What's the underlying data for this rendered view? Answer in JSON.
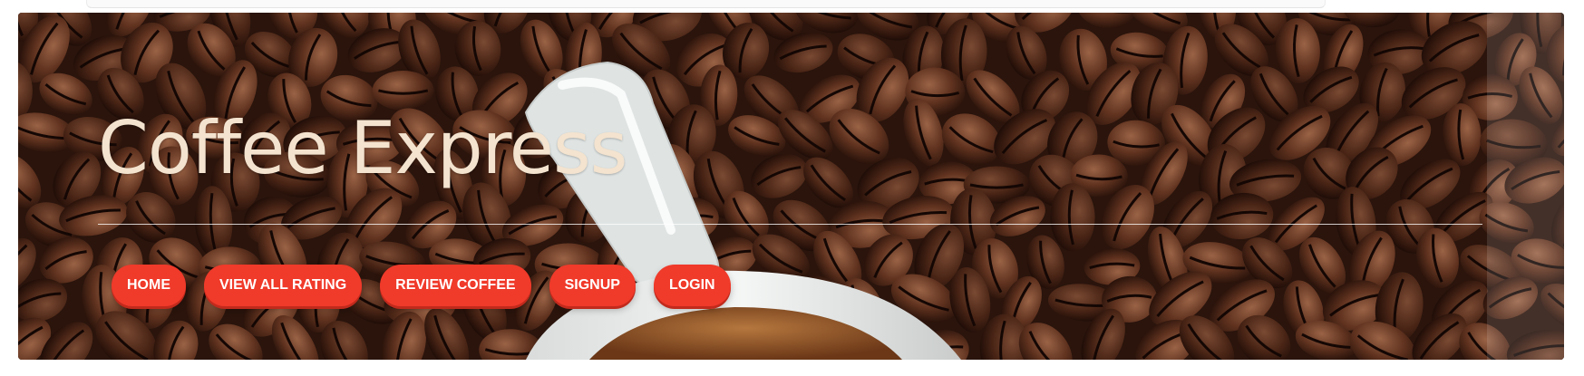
{
  "site": {
    "title": "Coffee Express"
  },
  "nav": {
    "items": [
      {
        "label": "HOME"
      },
      {
        "label": "VIEW ALL RATING"
      },
      {
        "label": "REVIEW COFFEE"
      },
      {
        "label": "SIGNUP"
      },
      {
        "label": "LOGIN"
      }
    ]
  },
  "colors": {
    "accent": "#f03a2a",
    "title": "#f3e3cf",
    "hero_background": "#3a1d12"
  },
  "hero": {
    "image": "coffee-beans-and-cup-photo"
  }
}
